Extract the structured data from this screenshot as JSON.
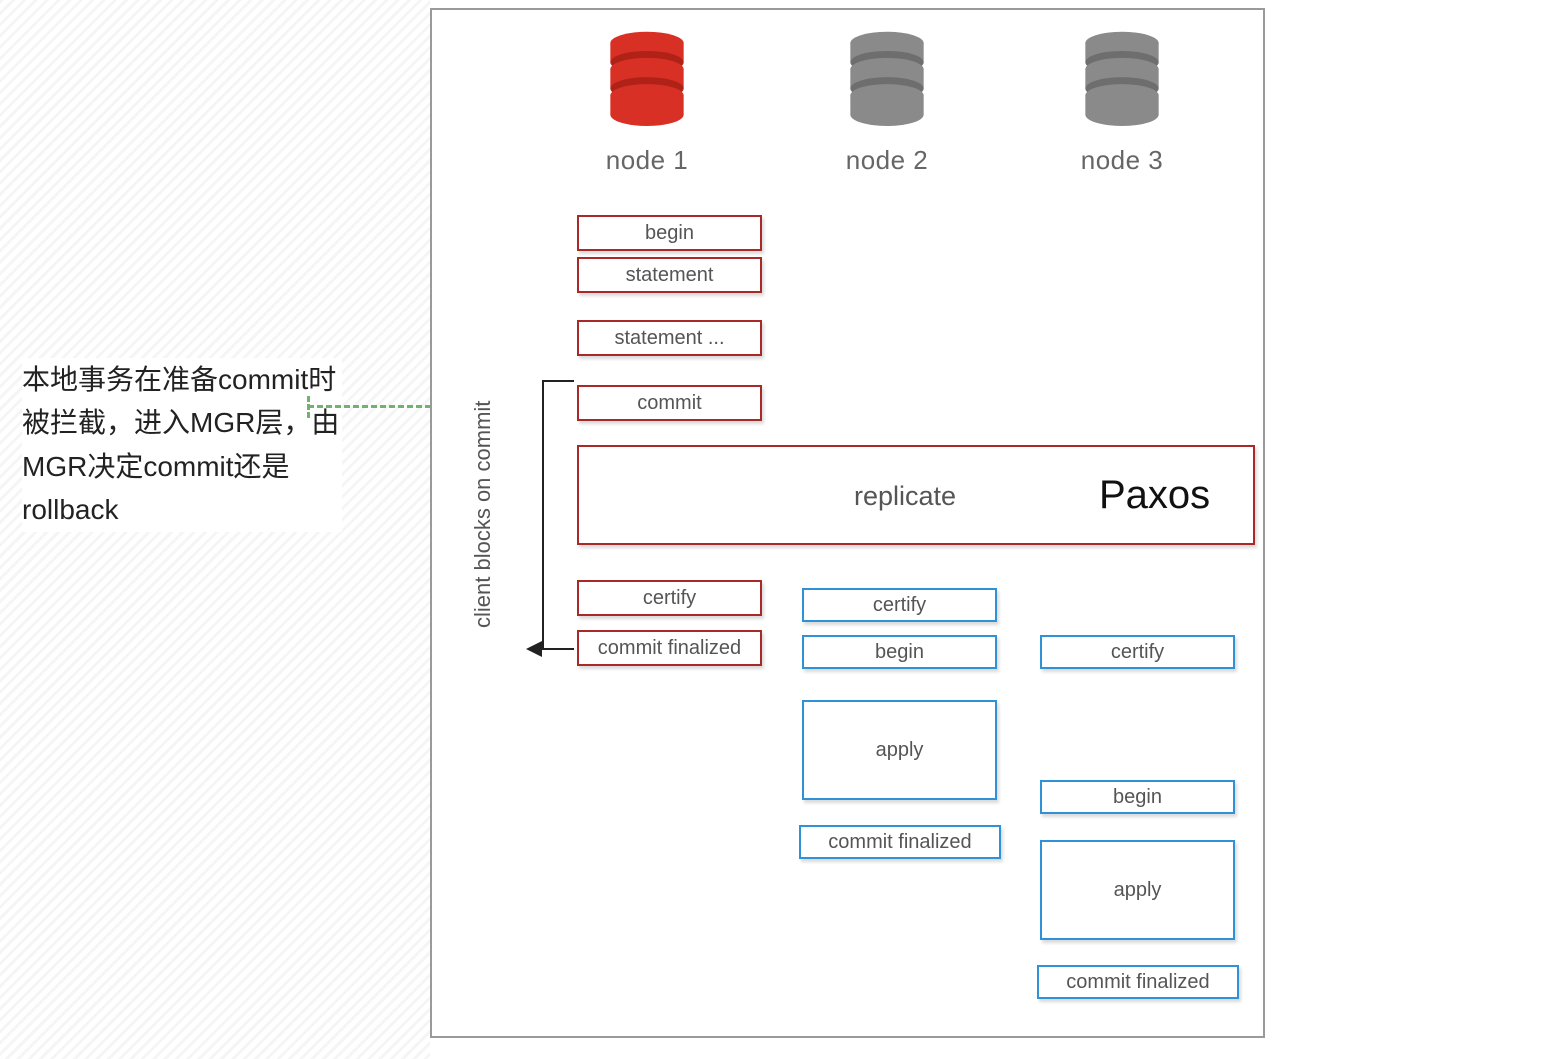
{
  "annotation": "本地事务在准备commit时被拦截，进入MGR层，由MGR决定commit还是rollback",
  "nodes": {
    "n1": "node 1",
    "n2": "node 2",
    "n3": "node 3"
  },
  "vlabel": "client blocks on commit",
  "replicate": "replicate",
  "paxos": "Paxos",
  "node1_steps": {
    "s0": "begin",
    "s1": "statement",
    "s2": "statement ...",
    "s3": "commit",
    "s4": "certify",
    "s5": "commit finalized"
  },
  "node2_steps": {
    "s0": "certify",
    "s1": "begin",
    "s2": "apply",
    "s3": "commit finalized"
  },
  "node3_steps": {
    "s0": "certify",
    "s1": "begin",
    "s2": "apply",
    "s3": "commit finalized"
  },
  "colors": {
    "red": "#d93025",
    "grey": "#8a8a8a"
  }
}
